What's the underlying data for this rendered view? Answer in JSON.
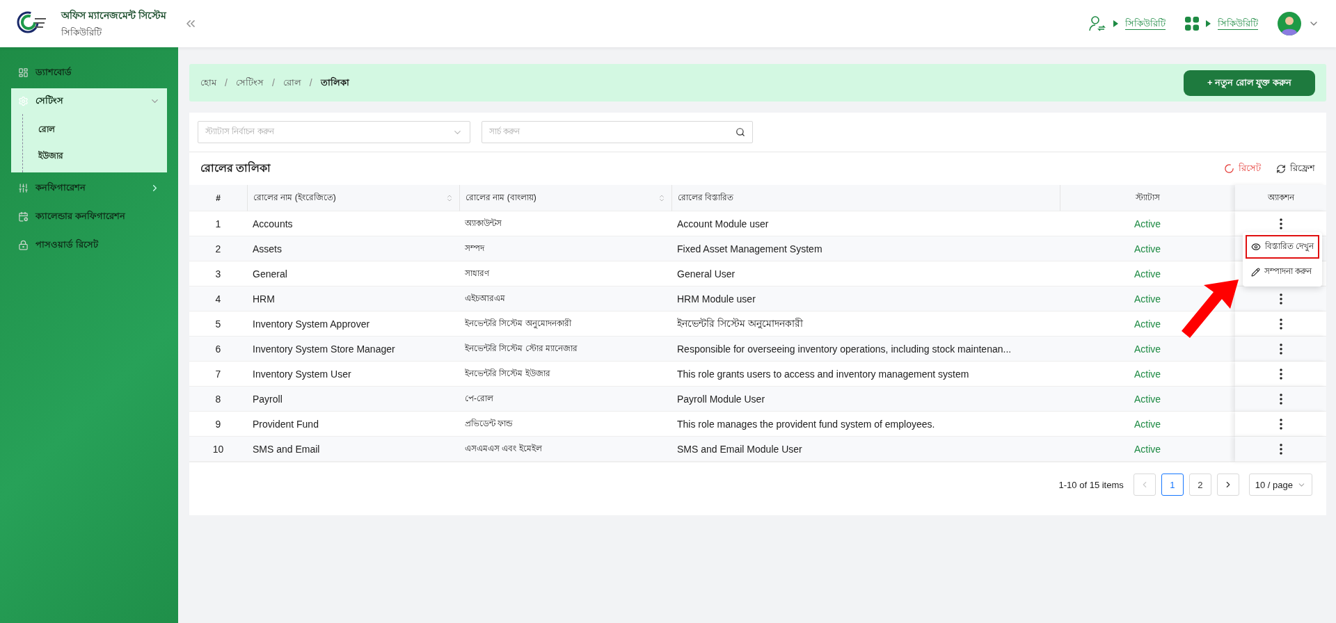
{
  "header": {
    "title": "অফিস ম্যানেজমেন্ট সিস্টেম",
    "subtitle": "সিকিউরিটি",
    "links": [
      "সিকিউরিটি",
      "সিকিউরিটি"
    ]
  },
  "sidebar": {
    "items": [
      {
        "label": "ড্যাশবোর্ড"
      },
      {
        "label": "সেটিংস",
        "expanded": true,
        "children": [
          {
            "label": "রোল"
          },
          {
            "label": "ইউজার"
          }
        ]
      },
      {
        "label": "কনফিগারেশন",
        "expanded": false
      },
      {
        "label": "ক্যালেন্ডার কনফিগারেশন"
      },
      {
        "label": "পাসওয়ার্ড রিসেট"
      }
    ]
  },
  "breadcrumb": [
    {
      "kind": "link",
      "text": "হোম"
    },
    {
      "kind": "separator",
      "text": "/"
    },
    {
      "kind": "link",
      "text": "সেটিংস"
    },
    {
      "kind": "separator",
      "text": "/"
    },
    {
      "kind": "link",
      "text": "রোল"
    },
    {
      "kind": "separator",
      "text": "/"
    },
    {
      "kind": "current",
      "text": "তালিকা"
    }
  ],
  "add_button": "+ নতুন রোল যুক্ত করুন",
  "filters": {
    "status_select": {
      "placeholder": "স্ট্যাটাস নির্বাচন করুন"
    },
    "search": {
      "placeholder": "সার্চ করুন"
    }
  },
  "table_title": "রোলের তালিকা",
  "reset_button": "রিসেট",
  "refresh_button": "রিফ্রেশ",
  "table": {
    "columns": [
      {
        "label": "#",
        "sortable": false
      },
      {
        "label": "রোলের নাম (ইংরেজিতে)",
        "sortable": true
      },
      {
        "label": "রোলের নাম (বাংলায়)",
        "sortable": true
      },
      {
        "label": "রোলের বিস্তারিত",
        "sortable": false
      },
      {
        "label": "স্ট্যাটাস",
        "sortable": false
      },
      {
        "label": "অ্যাকশন",
        "sortable": false
      }
    ],
    "rows": [
      {
        "no": "1",
        "name_en": "Accounts",
        "name_bn": "অ্যাকাউন্টস",
        "details": "Account Module user",
        "status": "Active",
        "action_button": true
      },
      {
        "no": "2",
        "name_en": "Assets",
        "name_bn": "সম্পদ",
        "details": "Fixed Asset Management System",
        "status": "Active",
        "action_button": false
      },
      {
        "no": "3",
        "name_en": "General",
        "name_bn": "সাধারণ",
        "details": "General User",
        "status": "Active",
        "action_button": false
      },
      {
        "no": "4",
        "name_en": "HRM",
        "name_bn": "এইচআরএম",
        "details": "HRM Module user",
        "status": "Active",
        "action_button": true
      },
      {
        "no": "5",
        "name_en": "Inventory System Approver",
        "name_bn": "ইনভেন্টরি সিস্টেম অনুমোদনকারী",
        "details": "ইনভেন্টরি সিস্টেম অনুমোদনকারী",
        "status": "Active",
        "action_button": true
      },
      {
        "no": "6",
        "name_en": "Inventory System Store Manager",
        "name_bn": "ইনভেন্টরি সিস্টেম স্টোর ম্যানেজার",
        "details": "Responsible for overseeing inventory operations, including stock maintenan...",
        "status": "Active",
        "action_button": true
      },
      {
        "no": "7",
        "name_en": "Inventory System User",
        "name_bn": "ইনভেন্টরি সিস্টেম ইউজার",
        "details": "This role grants users to access and inventory management system",
        "status": "Active",
        "action_button": true
      },
      {
        "no": "8",
        "name_en": "Payroll",
        "name_bn": "পে-রোল",
        "details": "Payroll Module User",
        "status": "Active",
        "action_button": true
      },
      {
        "no": "9",
        "name_en": "Provident Fund",
        "name_bn": "প্রভিডেন্ট ফান্ড",
        "details": "This role manages the provident fund system of employees.",
        "status": "Active",
        "action_button": true
      },
      {
        "no": "10",
        "name_en": "SMS and Email",
        "name_bn": "এসএমএস এবং ইমেইল",
        "details": "SMS and Email Module User",
        "status": "Active",
        "action_button": true
      }
    ]
  },
  "action_menu": {
    "items": [
      {
        "label": "বিস্তারিত দেখুন",
        "highlighted": true
      },
      {
        "label": "সম্পাদনা করুন",
        "highlighted": false
      }
    ]
  },
  "annotation_arrow": true,
  "pagination": {
    "summary": "1-10 of 15 items",
    "prev_disabled": true,
    "pages": [
      {
        "label": "1",
        "selected": true
      },
      {
        "label": "2",
        "selected": false
      }
    ],
    "page_size": "10 / page"
  }
}
